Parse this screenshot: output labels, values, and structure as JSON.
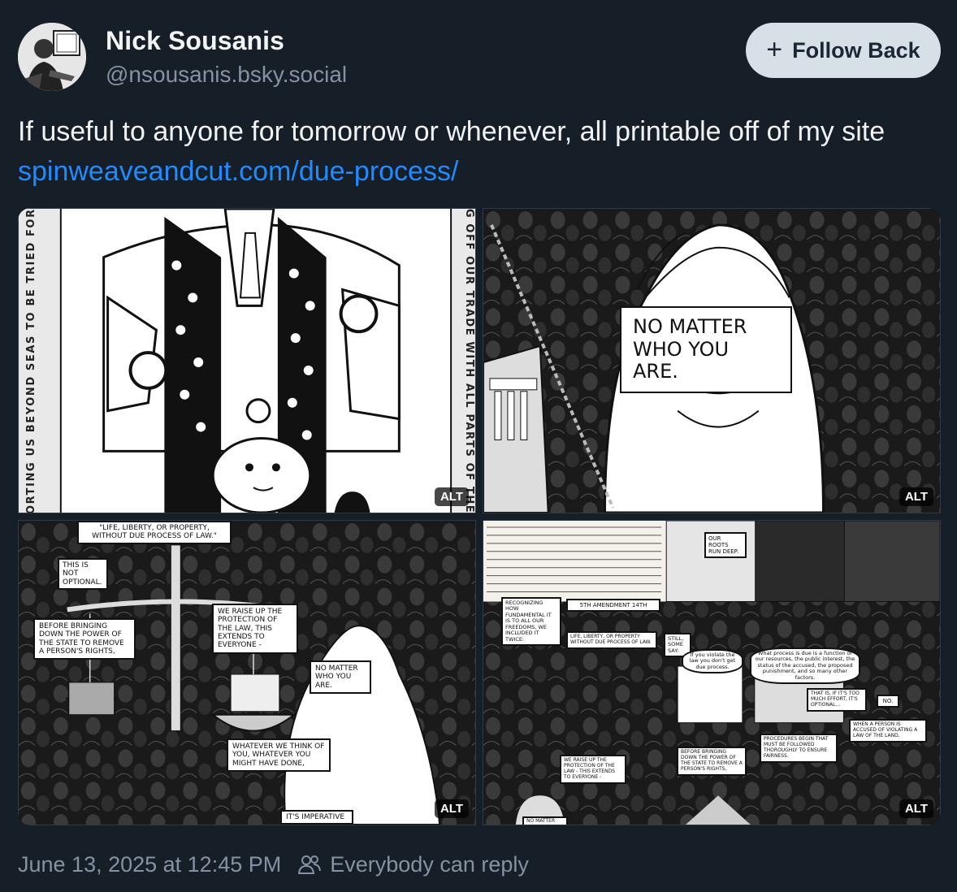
{
  "author": {
    "display_name": "Nick Sousanis",
    "handle": "@nsousanis.bsky.social"
  },
  "follow_button": {
    "label": "Follow Back",
    "icon": "plus-icon"
  },
  "post": {
    "text": "If useful to anyone for tomorrow or whenever, all printable off of my site ",
    "link": "spinweaveandcut.com/due-process/"
  },
  "images": {
    "alt_label": "ALT",
    "tile1": {
      "side_left": "ORTING US BEYOND SEAS TO BE TRIED FOR PRE",
      "side_right": "G OFF OUR TRADE WITH ALL PARTS OF THE"
    },
    "tile2": {
      "caption": "NO MATTER WHO YOU ARE."
    },
    "tile3": {
      "top": "\"LIFE, LIBERTY, OR PROPERTY, WITHOUT DUE PROCESS OF LAW.\"",
      "optional": "THIS IS NOT OPTIONAL.",
      "before": "BEFORE BRINGING DOWN THE POWER OF THE STATE TO REMOVE A PERSON'S RIGHTS,",
      "raise": "WE RAISE UP THE PROTECTION OF THE LAW, THIS EXTENDS TO EVERYONE -",
      "matter": "NO MATTER WHO YOU ARE.",
      "whatever": "WHATEVER WE THINK OF YOU, WHATEVER YOU MIGHT HAVE DONE,",
      "imperative": "IT'S IMPERATIVE"
    },
    "tile4": {
      "roots": "OUR ROOTS RUN DEEP.",
      "recognizing": "RECOGNIZING HOW FUNDAMENTAL IT IS TO ALL OUR FREEDOMS, WE INCLUDED IT TWICE:",
      "amendment": "5TH AMENDMENT 14TH",
      "life": "LIFE, LIBERTY, OR PROPERTY WITHOUT DUE PROCESS OF LAW.",
      "still": "STILL, SOME SAY:",
      "violate": "If you violate the law you don't get due process.",
      "process": "What process is due is a function of our resources, the public interest, the status of the accused, the proposed punishment, and so many other factors.",
      "effort": "THAT IS, IF IT'S TOO MUCH EFFORT, IT'S OPTIONAL...",
      "no": "NO.",
      "accused": "WHEN A PERSON IS ACCUSED OF VIOLATING A LAW OF THE LAND,",
      "procedures": "PROCEDURES BEGIN THAT MUST BE FOLLOWED THOROUGHLY TO ENSURE FAIRNESS.",
      "raise": "WE RAISE UP THE PROTECTION OF THE LAW - THIS EXTENDS TO EVERYONE -",
      "before": "BEFORE BRINGING DOWN THE POWER OF THE STATE TO REMOVE A PERSON'S RIGHTS,",
      "matter": "NO MATTER"
    }
  },
  "footer": {
    "timestamp": "June 13, 2025 at 12:45 PM",
    "reply_setting": "Everybody can reply",
    "reply_icon": "people-icon"
  },
  "colors": {
    "background": "#161e27",
    "text": "#f1f3f5",
    "muted": "#8592a3",
    "link": "#208bfe",
    "button_bg": "#d7dfe7"
  }
}
